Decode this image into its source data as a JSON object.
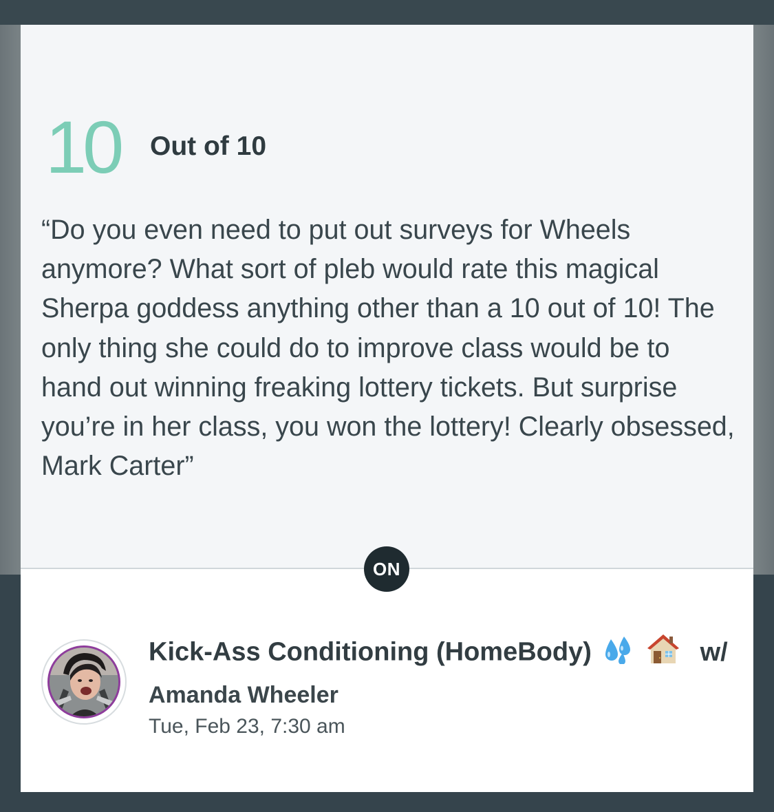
{
  "rating": {
    "score": "10",
    "out_of_label": "Out of 10",
    "accent_color": "#7ccdb6"
  },
  "review": {
    "quote": "“Do you even need to put out surveys for Wheels anymore? What sort of pleb would rate this magical Sherpa goddess anything other than a 10 out of 10! The only thing she could do to improve class would be to hand out winning freaking lottery tickets. But surprise you’re in her class, you won the lottery! Clearly obsessed, Mark Carter”"
  },
  "badge": {
    "label": "ON"
  },
  "class_info": {
    "title": "Kick-Ass Conditioning (HomeBody)",
    "title_icons": [
      "sweat-droplets-icon",
      "house-icon"
    ],
    "with_label": "w/",
    "instructor": "Amanda Wheeler",
    "datetime": "Tue, Feb 23, 7:30 am"
  },
  "colors": {
    "card_background": "#f4f6f8",
    "badge_background": "#1f2b30",
    "avatar_ring": "#8e3c9c"
  }
}
